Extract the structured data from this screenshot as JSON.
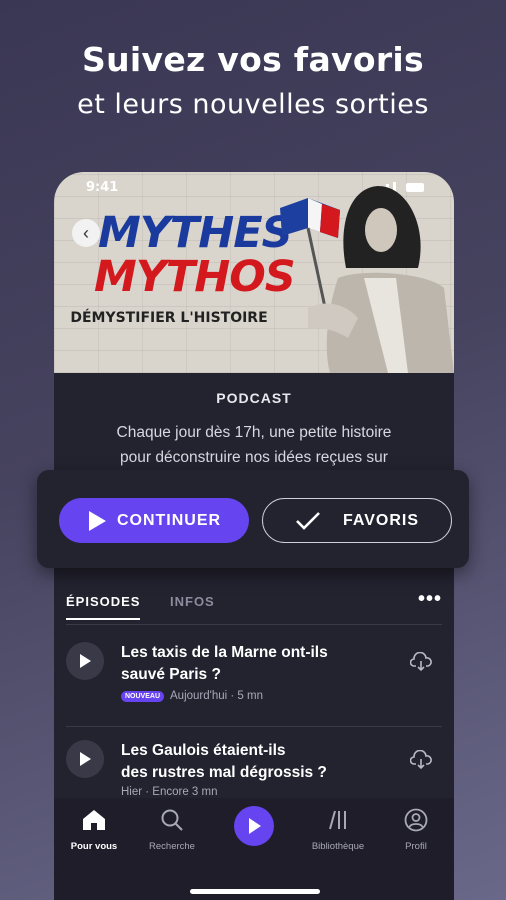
{
  "headline": {
    "line1": "Suivez vos favoris",
    "line2": "et leurs nouvelles sorties"
  },
  "status": {
    "time": "9:41"
  },
  "cover": {
    "title1": "MYTHES",
    "title2": "MYTHOS",
    "subtitle": "DÉMYSTIFIER L'HISTOIRE"
  },
  "podcast": {
    "label": "PODCAST",
    "description_line1": "Chaque jour dès 17h, une petite histoire",
    "description_line2": "pour déconstruire nos idées reçues sur"
  },
  "actions": {
    "continue_label": "CONTINUER",
    "favorite_label": "FAVORIS"
  },
  "tabs": {
    "episodes": "ÉPISODES",
    "infos": "INFOS",
    "more": "•••"
  },
  "episodes": [
    {
      "title_line1": "Les taxis de la Marne ont-ils",
      "title_line2": "sauvé Paris ?",
      "badge": "NOUVEAU",
      "meta": "Aujourd'hui · 5 mn"
    },
    {
      "title_line1": "Les Gaulois étaient-ils",
      "title_line2": "des rustres mal dégrossis ?",
      "badge": "",
      "meta": "Hier · Encore 3 mn"
    }
  ],
  "nav": [
    {
      "label": "Pour vous",
      "icon": "home-icon"
    },
    {
      "label": "Recherche",
      "icon": "search-icon"
    },
    {
      "label": "",
      "icon": "play-icon"
    },
    {
      "label": "Bibliothèque",
      "icon": "library-icon"
    },
    {
      "label": "Profil",
      "icon": "profile-icon"
    }
  ],
  "colors": {
    "accent": "#6644f0",
    "card": "#23222f",
    "blue": "#1b3a9e",
    "red": "#d3191e"
  }
}
